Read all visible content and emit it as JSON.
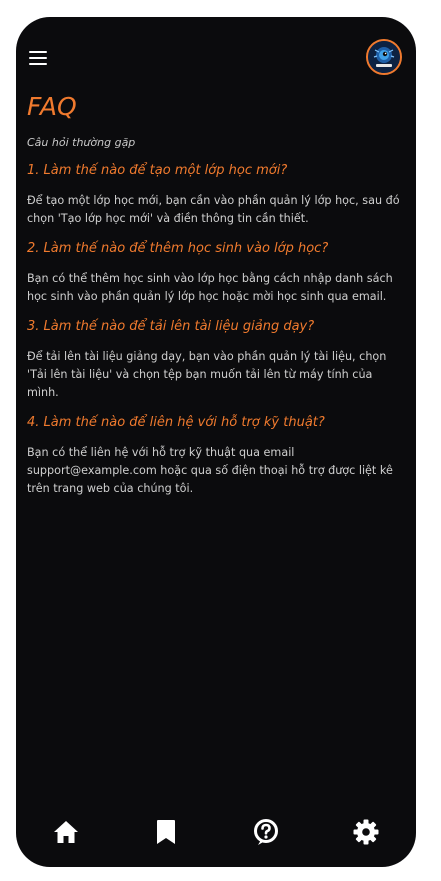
{
  "header": {
    "menu_icon": "menu-icon",
    "avatar_icon": "avatar-logo"
  },
  "page": {
    "title": "FAQ",
    "subtitle": "Câu hỏi thường gặp"
  },
  "faq": [
    {
      "question": "1. Làm thế nào để tạo một lớp học mới?",
      "answer": "Để tạo một lớp học mới, bạn cần vào phần quản lý lớp học, sau đó chọn 'Tạo lớp học mới' và điền thông tin cần thiết."
    },
    {
      "question": "2. Làm thế nào để thêm học sinh vào lớp học?",
      "answer": "Bạn có thể thêm học sinh vào lớp học bằng cách nhập danh sách học sinh vào phần quản lý lớp học hoặc mời học sinh qua email."
    },
    {
      "question": "3. Làm thế nào để tải lên tài liệu giảng dạy?",
      "answer": "Để tải lên tài liệu giảng dạy, bạn vào phần quản lý tài liệu, chọn 'Tải lên tài liệu' và chọn tệp bạn muốn tải lên từ máy tính của mình."
    },
    {
      "question": "4. Làm thế nào để liên hệ với hỗ trợ kỹ thuật?",
      "answer": "Bạn có thể liên hệ với hỗ trợ kỹ thuật qua email support@example.com hoặc qua số điện thoại hỗ trợ được liệt kê trên trang web của chúng tôi."
    }
  ],
  "bottom_nav": {
    "items": [
      "home-icon",
      "bookmark-icon",
      "help-icon",
      "settings-icon"
    ]
  },
  "colors": {
    "accent": "#f07a2e",
    "background": "#0b0b0d",
    "text": "#cfcfcf"
  }
}
